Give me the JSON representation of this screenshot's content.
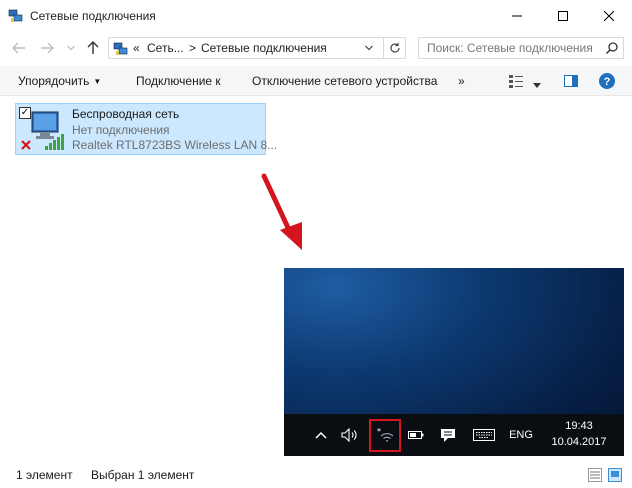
{
  "window": {
    "title": "Сетевые подключения",
    "minimize_icon": "minimize-icon",
    "maximize_icon": "maximize-icon",
    "close_icon": "close-icon"
  },
  "address_bar": {
    "overflow": "«",
    "crumbs": [
      "Сеть...",
      "Сетевые подключения"
    ],
    "separator": ">",
    "search_placeholder": "Поиск: Сетевые подключения"
  },
  "toolbar": {
    "organize": "Упорядочить",
    "connect": "Подключение к",
    "disconnect": "Отключение сетевого устройства",
    "more": "»"
  },
  "connection": {
    "name": "Беспроводная сеть",
    "status": "Нет подключения",
    "adapter": "Realtek RTL8723BS Wireless LAN 8..."
  },
  "inset": {
    "language": "ENG",
    "time": "19:43",
    "date": "10.04.2017"
  },
  "status_bar": {
    "count": "1 элемент",
    "selected": "Выбран 1 элемент"
  },
  "colors": {
    "accent": "#0078d7",
    "selection": "#cce8ff",
    "arrow": "#d4141f",
    "highlight": "#d4141f"
  }
}
